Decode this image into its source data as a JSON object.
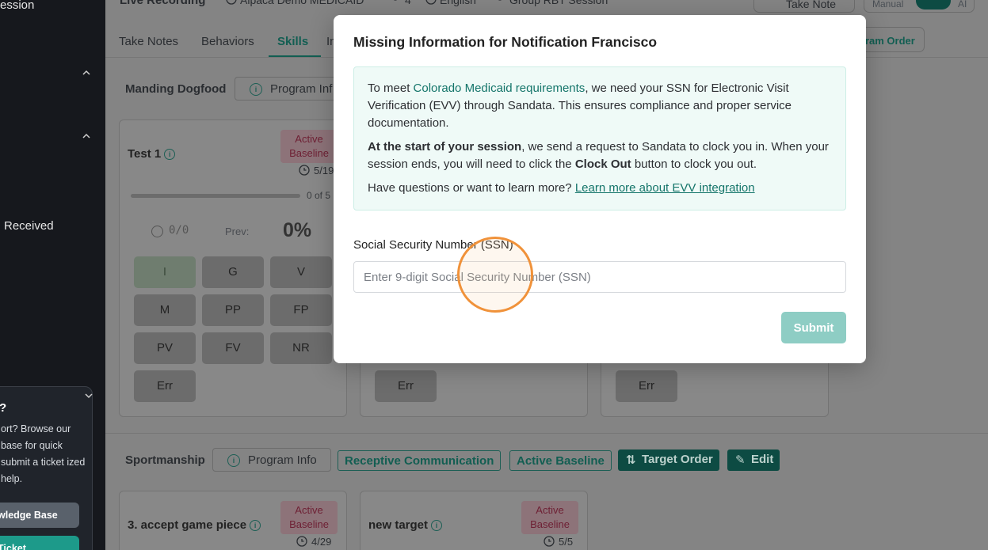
{
  "sidebar": {
    "session_label": "ession",
    "received_label": "Received",
    "help": {
      "question": "?",
      "text": "ort? Browse our base for quick submit a ticket ized help.",
      "knowledge_base_label": "wledge Base",
      "ticket_label": "Ticket"
    }
  },
  "topbar": {
    "title": "Live Recording",
    "client": "Alpaca Demo MEDICAID",
    "count": "4",
    "language": "English",
    "session_type": "Group RBT Session",
    "take_note_label": "Take Note",
    "mode_manual": "Manual",
    "mode_ai": "AI"
  },
  "tabs": [
    "Take Notes",
    "Behaviors",
    "Skills",
    "In"
  ],
  "active_tab": "Skills",
  "program_order_label": "gram Order",
  "program1": {
    "name": "Manding Dogfood",
    "program_info_label": "Program Inf"
  },
  "card1": {
    "title": "Test 1",
    "badge": [
      "Active",
      "Baseline"
    ],
    "date": "5/19",
    "progress_text": "0 of 5",
    "count": "0/0",
    "prev_label": "Prev:",
    "percent": "0%",
    "keys": [
      "I",
      "G",
      "V",
      "M",
      "PP",
      "FP",
      "PV",
      "FV",
      "NR",
      "Err"
    ]
  },
  "card2": {
    "key": "Err"
  },
  "card3": {
    "key": "Err"
  },
  "program2": {
    "name": "Sportmanship",
    "program_info_label": "Program Info",
    "tag1": "Receptive Communication",
    "tag2": "Active Baseline",
    "target_order_label": "Target Order",
    "edit_label": "Edit"
  },
  "card4": {
    "title": "3. accept game piece",
    "badge": [
      "Active",
      "Baseline"
    ],
    "date": "4/29"
  },
  "card5": {
    "title": "new target",
    "badge": [
      "Active",
      "Baseline"
    ],
    "date": "5/5"
  },
  "modal": {
    "title": "Missing Information for Notification Francisco",
    "p1_start": "To meet ",
    "p1_highlight": "Colorado Medicaid requirements",
    "p1_end": ", we need your SSN for Electronic Visit Verification (EVV) through Sandata. This ensures compliance and proper service documentation.",
    "p2_bold1": "At the start of your session",
    "p2_mid": ", we send a request to Sandata to clock you in. When your session ends, you will need to click the ",
    "p2_bold2": "Clock Out",
    "p2_end": " button to clock you out.",
    "p3_text": "Have questions or want to learn more? ",
    "p3_link": "Learn more about EVV integration",
    "ssn_label": "Social Security Number (SSN)",
    "ssn_placeholder": "Enter 9-digit Social Security Number (SSN)",
    "ssn_value": "",
    "submit_label": "Submit"
  },
  "colors": {
    "accent": "#14756a",
    "submit_disabled": "#8ecdc4",
    "cursor_ring": "#f0923a"
  }
}
